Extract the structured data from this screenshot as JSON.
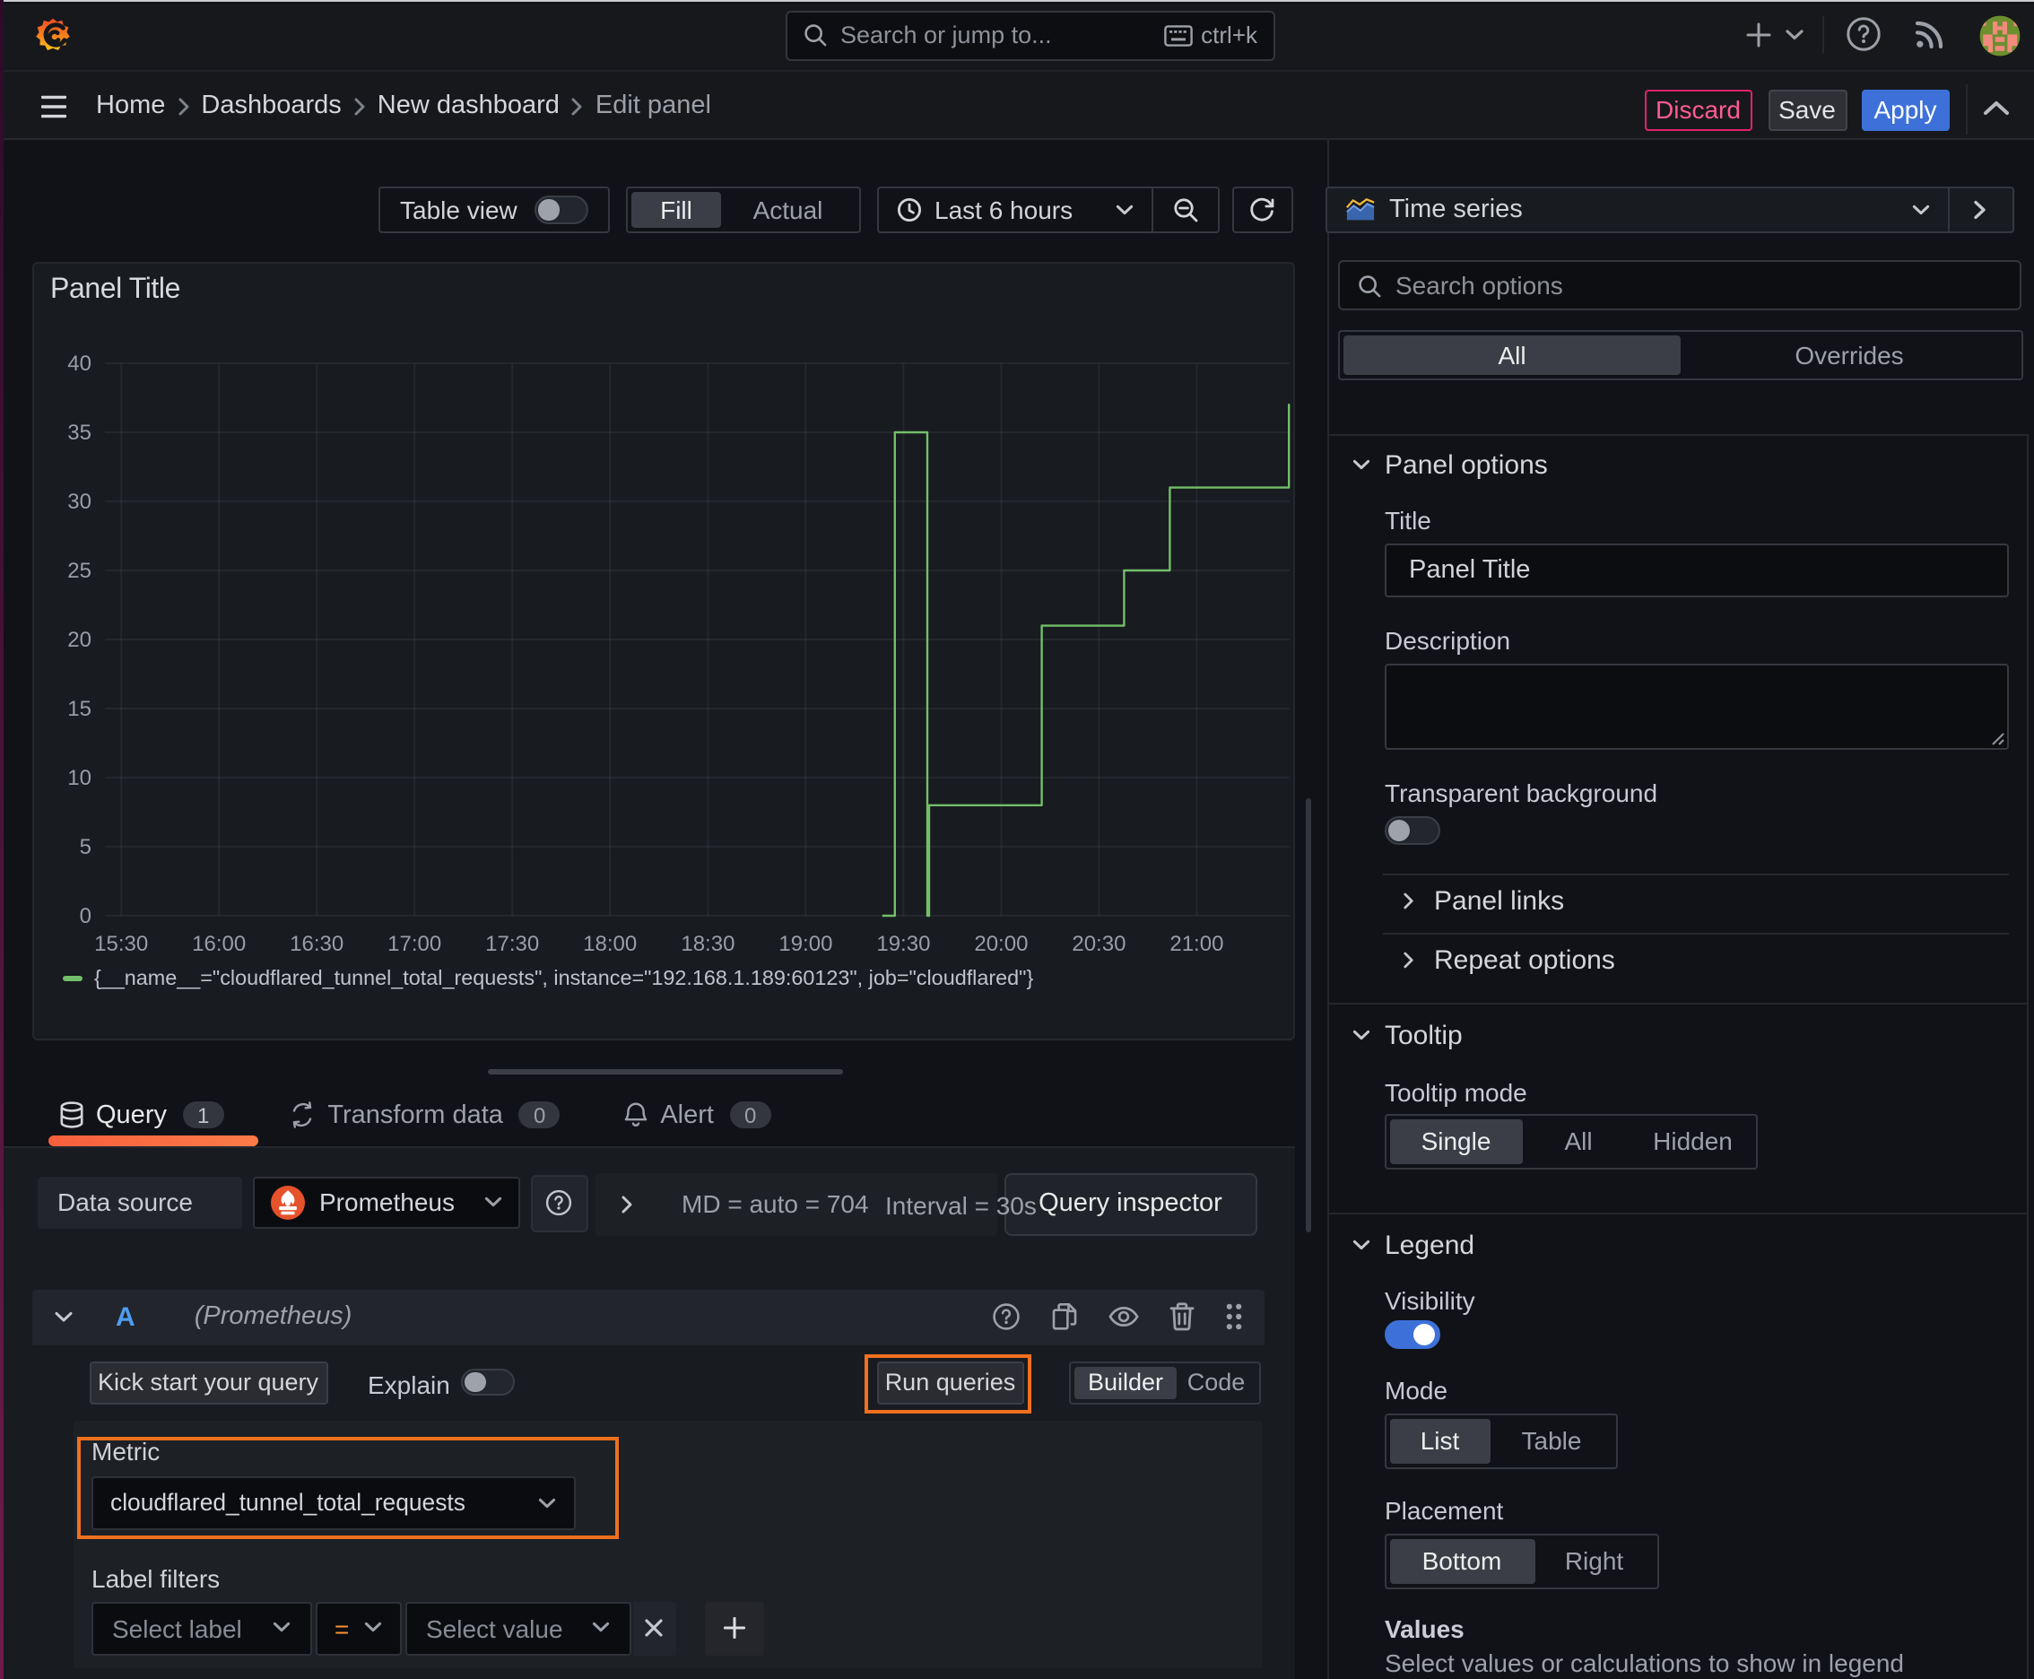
{
  "window": {
    "top_stripe": "#cdcdd0",
    "left_stripe_top": "#2c0b29",
    "left_stripe_bottom": "#6e1c4c"
  },
  "topbar": {
    "search_placeholder": "Search or jump to...",
    "shortcut": "ctrl+k"
  },
  "breadcrumbs": {
    "items": [
      "Home",
      "Dashboards",
      "New dashboard",
      "Edit panel"
    ]
  },
  "actions": {
    "discard": "Discard",
    "save": "Save",
    "apply": "Apply"
  },
  "toolbar": {
    "table_view": "Table view",
    "fill": "Fill",
    "actual": "Actual",
    "time_range": "Last 6 hours"
  },
  "panel": {
    "title": "Panel Title"
  },
  "chart_data": {
    "type": "line",
    "title": "Panel Title",
    "step": true,
    "x_range_hours": [
      15.4167,
      21.475
    ],
    "x_tick_hours": [
      15.5,
      16,
      16.5,
      17,
      17.5,
      18,
      18.5,
      19,
      19.5,
      20,
      20.5,
      21
    ],
    "x_ticks": [
      "15:30",
      "16:00",
      "16:30",
      "17:00",
      "17:30",
      "18:00",
      "18:30",
      "19:00",
      "19:30",
      "20:00",
      "20:30",
      "21:00"
    ],
    "y_ticks": [
      0,
      5,
      10,
      15,
      20,
      25,
      30,
      35,
      40
    ],
    "ylim": [
      0,
      40
    ],
    "grid": true,
    "legend_position": "bottom",
    "series": [
      {
        "name": "{__name__=\"cloudflared_tunnel_total_requests\", instance=\"192.168.1.189:60123\", job=\"cloudflared\"}",
        "color": "#73bf69",
        "points": [
          [
            19.392,
            0
          ],
          [
            19.456,
            35
          ],
          [
            19.622,
            0
          ],
          [
            19.631,
            8
          ],
          [
            20.207,
            21
          ],
          [
            20.628,
            25
          ],
          [
            20.862,
            31
          ],
          [
            21.471,
            37
          ]
        ]
      }
    ]
  },
  "query_section": {
    "tabs": [
      {
        "label": "Query",
        "count": "1"
      },
      {
        "label": "Transform data",
        "count": "0"
      },
      {
        "label": "Alert",
        "count": "0"
      }
    ],
    "datasource_label": "Data source",
    "datasource": "Prometheus",
    "summary_md": "MD = auto = 704",
    "summary_interval": "Interval = 30s",
    "query_inspector": "Query inspector",
    "ref_id": "A",
    "ds_hint": "(Prometheus)",
    "kick_start": "Kick start your query",
    "explain": "Explain",
    "run_queries": "Run queries",
    "builder": "Builder",
    "code": "Code",
    "metric_label": "Metric",
    "metric_value": "cloudflared_tunnel_total_requests",
    "label_filters": "Label filters",
    "select_label": "Select label",
    "operator": "=",
    "select_value": "Select value",
    "annotation_color": "#f0701e"
  },
  "options_pane": {
    "visualization": "Time series",
    "search_placeholder": "Search options",
    "tab_all": "All",
    "tab_overrides": "Overrides",
    "panel_options": {
      "heading": "Panel options",
      "title_label": "Title",
      "title_value": "Panel Title",
      "description_label": "Description",
      "transparent_label": "Transparent background",
      "panel_links": "Panel links",
      "repeat_options": "Repeat options"
    },
    "tooltip": {
      "heading": "Tooltip",
      "mode_label": "Tooltip mode",
      "modes": [
        "Single",
        "All",
        "Hidden"
      ],
      "selected": "Single"
    },
    "legend": {
      "heading": "Legend",
      "visibility_label": "Visibility",
      "visibility_on": true,
      "mode_label": "Mode",
      "modes": [
        "List",
        "Table"
      ],
      "mode_selected": "List",
      "placement_label": "Placement",
      "placements": [
        "Bottom",
        "Right"
      ],
      "placement_selected": "Bottom",
      "values_label": "Values",
      "values_hint": "Select values or calculations to show in legend"
    },
    "accent_blue": "#3d71d9",
    "series_green": "#73bf69"
  }
}
